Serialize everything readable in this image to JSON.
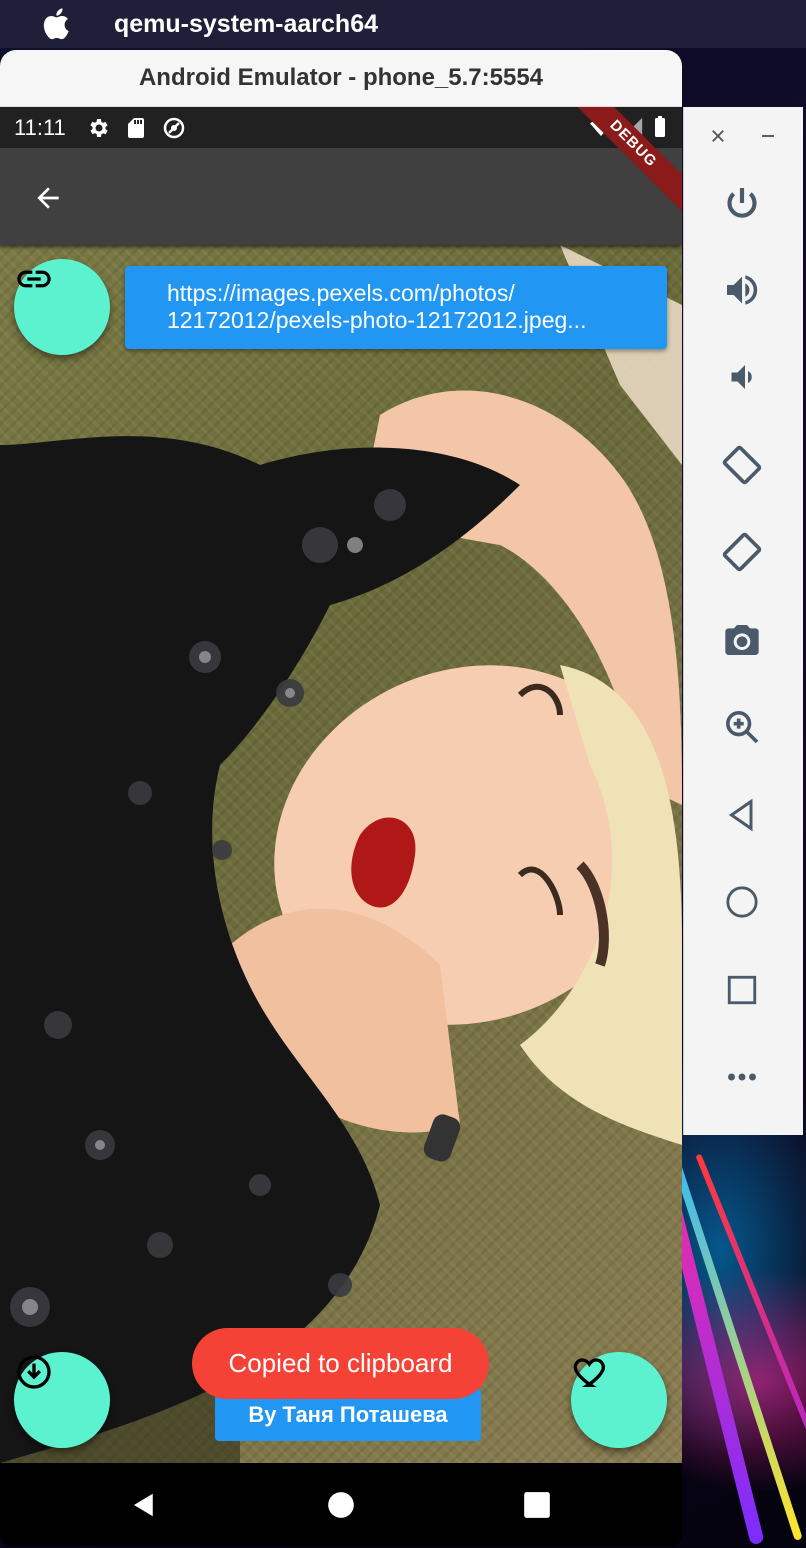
{
  "mac": {
    "app_name": "qemu-system-aarch64"
  },
  "window": {
    "title": "Android Emulator - phone_5.7:5554"
  },
  "status_bar": {
    "time": "11:11",
    "debug_label": "DEBUG"
  },
  "photo_url": {
    "line1": "https://images.pexels.com/photos/",
    "line2": "12172012/pexels-photo-12172012.jpeg..."
  },
  "author_button": {
    "label": "By Таня Поташева"
  },
  "toast": {
    "message": "Copied to clipboard"
  },
  "colors": {
    "fab": "#5cf2cf",
    "blue": "#2196f3",
    "toast": "#f44336",
    "appbar": "#404040"
  },
  "side_toolbar": {
    "items": [
      "close-icon",
      "minimize-icon",
      "power-icon",
      "volume-up-icon",
      "volume-down-icon",
      "rotate-left-icon",
      "rotate-right-icon",
      "camera-icon",
      "zoom-icon",
      "back-icon",
      "home-icon",
      "overview-icon",
      "more-icon"
    ]
  }
}
